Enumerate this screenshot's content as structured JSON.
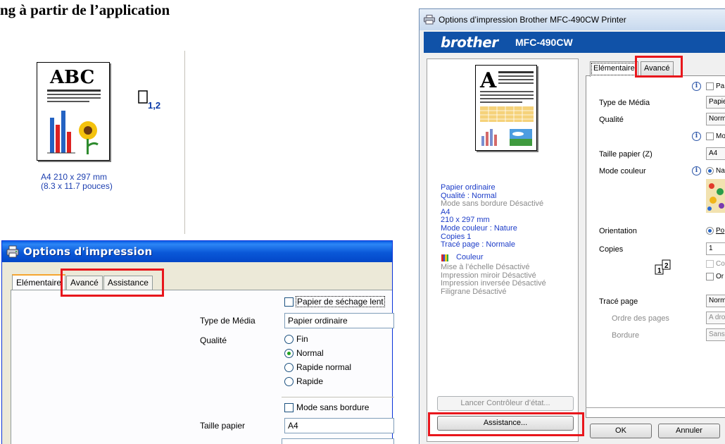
{
  "doc_heading": "ng à partir de l’application",
  "xp_dialog": {
    "title": "Options d'impression",
    "tabs": [
      "Elémentaire",
      "Avancé",
      "Assistance"
    ],
    "copies_value": "1,2",
    "paper_size_line1": "A4 210 x 297 mm",
    "paper_size_line2": "(8.3 x 11.7 pouces)",
    "slow_dry_label": "Papier de séchage lent",
    "media_type_label": "Type de Média",
    "media_type_value": "Papier ordinaire",
    "quality_label": "Qualité",
    "quality_options": [
      "Fin",
      "Normal",
      "Rapide normal",
      "Rapide"
    ],
    "quality_selected": "Normal",
    "borderless_label": "Mode sans bordure",
    "paper_size_label": "Taille papier",
    "paper_size_value": "A4",
    "preview_text": "ABC"
  },
  "vista_dialog": {
    "title": "Options d’impression Brother MFC-490CW Printer",
    "brand": "brother",
    "model": "MFC-490CW",
    "info_lines": [
      {
        "text": "Papier ordinaire",
        "style": "blue"
      },
      {
        "text": "Qualité : Normal",
        "style": "blue"
      },
      {
        "text": "Mode sans bordure Désactivé",
        "style": "gray"
      },
      {
        "text": "A4",
        "style": "blue"
      },
      {
        "text": "210 x 297 mm",
        "style": "blue"
      },
      {
        "text": "Mode couleur : Nature",
        "style": "blue"
      },
      {
        "text": "Copies 1",
        "style": "blue"
      },
      {
        "text": "Tracé page : Normale",
        "style": "blue"
      }
    ],
    "color_label": "Couleur",
    "color_info_lines": [
      "Mise à l’échelle Désactivé",
      "Impression miroir Désactivé",
      "Impression inversée Désactivé",
      "Filigrane Désactivé"
    ],
    "status_monitor_button": "Lancer Contrôleur d’état...",
    "support_button": "Assistance...",
    "tabs": [
      "Elémentaire",
      "Avancé"
    ],
    "media_type_label": "Type de Média",
    "media_type_value": "Papie",
    "quality_label": "Qualité",
    "quality_value": "Norm",
    "paper_size_label": "Taille papier (Z)",
    "paper_size_value": "A4",
    "color_mode_label": "Mode couleur",
    "color_mode_option": "Na",
    "orientation_label": "Orientation",
    "orientation_option": "Po",
    "copies_label": "Copies",
    "copies_value": "1",
    "collate_label": "Co",
    "reverse_label": "Or",
    "page_layout_label": "Tracé page",
    "page_layout_value": "Norm",
    "page_order_label": "Ordre des pages",
    "page_order_value": "A dro",
    "border_label": "Bordure",
    "border_value": "Sans",
    "slow_dry_label": "Pa",
    "borderless_label": "Mo",
    "ok_button": "OK",
    "cancel_button": "Annuler",
    "pages_icon_digits": [
      "1",
      "2"
    ]
  },
  "colors": {
    "highlight": "#e8161c",
    "brother_blue": "#1052a8",
    "xp_title_blue": "#0a58d8",
    "info_blue": "#1c3cc8"
  }
}
